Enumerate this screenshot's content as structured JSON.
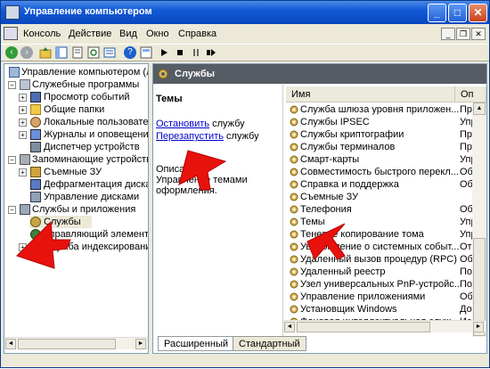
{
  "window": {
    "title": "Управление компьютером",
    "controls": {
      "minimize": "_",
      "maximize": "□",
      "close": "✕"
    }
  },
  "menubar": {
    "items": [
      "Консоль",
      "Действие",
      "Вид",
      "Окно",
      "Справка"
    ],
    "mdi_controls": {
      "minimize": "_",
      "restore": "❐",
      "close": "✕"
    }
  },
  "tree": {
    "items": [
      {
        "label": "Управление компьютером (ло",
        "expander": "",
        "icon": "computer-management-icon"
      },
      {
        "label": "Служебные программы",
        "expander": "−",
        "icon": "tools-icon"
      },
      {
        "label": "Просмотр событий",
        "expander": "+",
        "icon": "event-viewer-icon"
      },
      {
        "label": "Общие папки",
        "expander": "+",
        "icon": "shared-folders-icon"
      },
      {
        "label": "Локальные пользовател",
        "expander": "+",
        "icon": "local-users-icon"
      },
      {
        "label": "Журналы и оповещени",
        "expander": "+",
        "icon": "performance-logs-icon"
      },
      {
        "label": "Диспетчер устройств",
        "expander": "",
        "icon": "device-manager-icon"
      },
      {
        "label": "Запоминающие устройств",
        "expander": "−",
        "icon": "storage-icon"
      },
      {
        "label": "Съемные ЗУ",
        "expander": "+",
        "icon": "removable-storage-icon"
      },
      {
        "label": "Дефрагментация диска",
        "expander": "",
        "icon": "defrag-icon"
      },
      {
        "label": "Управление дисками",
        "expander": "",
        "icon": "disk-management-icon"
      },
      {
        "label": "Службы и приложения",
        "expander": "−",
        "icon": "services-apps-icon"
      },
      {
        "label": "Службы",
        "expander": "",
        "icon": "services-icon"
      },
      {
        "label": "Управляющий элемент",
        "expander": "",
        "icon": "wmi-icon"
      },
      {
        "label": "Служба индексировани",
        "expander": "+",
        "icon": "indexing-icon"
      }
    ]
  },
  "right_pane": {
    "header_title": "Службы",
    "description": {
      "service_name": "Темы",
      "stop_link": "Остановить",
      "stop_suffix": " службу",
      "restart_link": "Перезапустить",
      "restart_suffix": " службу",
      "description_lines": [
        "Описан",
        "Управление темами",
        "оформления."
      ]
    },
    "columns": {
      "name": "Имя",
      "description": "Оп"
    },
    "services": [
      {
        "name": "Служба шлюза уровня приложен...",
        "desc": "Пре"
      },
      {
        "name": "Службы IPSEC",
        "desc": "Упр"
      },
      {
        "name": "Службы криптографии",
        "desc": "Пре"
      },
      {
        "name": "Службы терминалов",
        "desc": "Пре"
      },
      {
        "name": "Смарт-карты",
        "desc": "Упр"
      },
      {
        "name": "Совместимость быстрого перекл...",
        "desc": "Обе"
      },
      {
        "name": "Справка и поддержка",
        "desc": "Обе"
      },
      {
        "name": "Съемные ЗУ",
        "desc": ""
      },
      {
        "name": "Телефония",
        "desc": "Обе"
      },
      {
        "name": "Темы",
        "desc": "Упр"
      },
      {
        "name": "Теневое копирование тома",
        "desc": "Упр"
      },
      {
        "name": "Уведомление о системных событ...",
        "desc": "Отс"
      },
      {
        "name": "Удаленный вызов процедур (RPC)",
        "desc": "Обе"
      },
      {
        "name": "Удаленный реестр",
        "desc": "Поз"
      },
      {
        "name": "Узел универсальных PnP-устройс...",
        "desc": "Под"
      },
      {
        "name": "Управление приложениями",
        "desc": "Обе"
      },
      {
        "name": "Установщик Windows",
        "desc": "Доб"
      },
      {
        "name": "Фоновая интеллектуальная служ...",
        "desc": "Исп"
      }
    ],
    "tabs": {
      "extended": "Расширенный",
      "standard": "Стандартный"
    }
  },
  "colors": {
    "titlebar": "#0a47c0",
    "pane_header": "#555c63",
    "link": "#0000cc",
    "annotation_arrow": "#e8120c"
  }
}
